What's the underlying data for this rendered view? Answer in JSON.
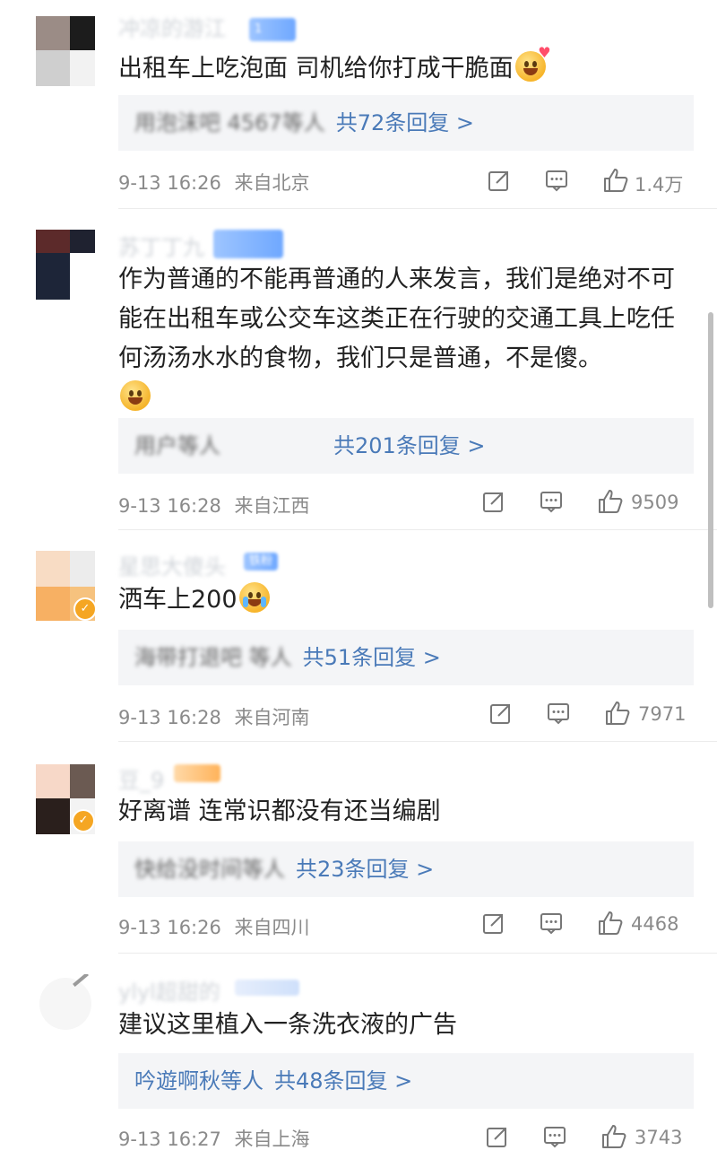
{
  "comments": [
    {
      "username": "冲凉的游江",
      "user_badge": "1",
      "text": "出租车上吃泡面 司机给你打成干脆面",
      "emoji": "heart-eyes-emoji",
      "reply_names": "用泡沫吧 4567等人",
      "reply_count": "共72条回复 >",
      "time": "9-13 16:26",
      "location": "来自北京",
      "likes": "1.4万"
    },
    {
      "username": "苏丁丁九",
      "user_badge": "",
      "text": "作为普通的不能再普通的人来发言，我们是绝对不可能在出租车或公交车这类正在行驶的交通工具上吃任何汤汤水水的食物，我们只是普通，不是傻。",
      "emoji": "laugh-cry-emoji",
      "reply_names": "用户等人",
      "reply_count": "共201条回复 >",
      "time": "9-13 16:28",
      "location": "来自江西",
      "likes": "9509"
    },
    {
      "username": "星思大傻头",
      "user_badge": "铁粉",
      "text": "洒车上200",
      "emoji": "crying-emoji",
      "reply_names": "海带打退吧 等人",
      "reply_count": "共51条回复 >",
      "time": "9-13 16:28",
      "location": "来自河南",
      "likes": "7971"
    },
    {
      "username": "豆_9",
      "user_badge": "",
      "text": "好离谱 连常识都没有还当编剧",
      "emoji": "",
      "reply_names": "快给没时间等人",
      "reply_count": "共23条回复 >",
      "time": "9-13 16:26",
      "location": "来自四川",
      "likes": "4468"
    },
    {
      "username": "ylyl超甜的",
      "user_badge": "",
      "text": "建议这里植入一条洗衣液的广告",
      "emoji": "",
      "reply_names": "吟遊啊秋等人",
      "reply_count": "共48条回复 >",
      "time": "9-13 16:27",
      "location": "来自上海",
      "likes": "3743"
    }
  ],
  "reply_ren": "等人",
  "colors": {
    "link": "#4a7ab8",
    "meta": "#8a8a8a",
    "reply_bg": "#f4f5f7"
  }
}
